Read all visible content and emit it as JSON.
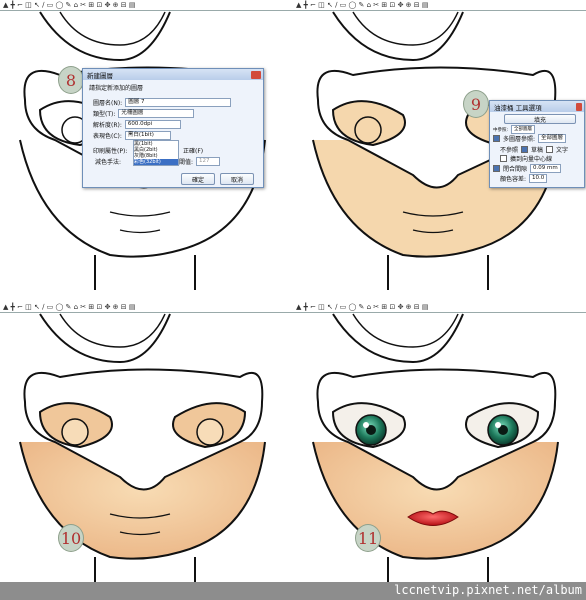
{
  "toolbar_glyphs": "▲ ╋ ⌐ ◫ ↖ ∕ ▭ ◯ ✎ ⌂ ✂ ⊞ ⊡ ✥ ⊕ ⊟ ▤",
  "steps": [
    "8",
    "9",
    "10",
    "11"
  ],
  "new_layer_dialog": {
    "title": "新建圖層",
    "prompt": "請指定新添加的圖層",
    "name_label": "圖層名(N):",
    "name_value": "圖層 7",
    "type_label": "類型(T):",
    "type_value": "光柵圖層",
    "resolution_label": "解析度(R):",
    "resolution_value": "600.0dpi",
    "color_label": "表現色(C):",
    "color_value": "黑白(1bit)",
    "options": [
      "黑(1bit)",
      "黑白(2bit)",
      "灰階(8bit)",
      "彩色(32bit)"
    ],
    "print_label": "印刷屬性(P):",
    "screen_label": "減色手法:",
    "normal_label": "正確(F)",
    "threshold_label": "閾值:",
    "threshold_value": "127",
    "ok_label": "確定",
    "cancel_label": "取消"
  },
  "fill_tool_options": {
    "title": "油漆桶 工具選項",
    "fill_button": "填充",
    "multi_layer_label": "多圖層參照:",
    "multi_layer_value": "全部圖層",
    "opt_not_ref": "不參照",
    "opt_draft": "草稿",
    "opt_text": "文字",
    "expand_center": "擴到向量中心線",
    "close_gap_label": "閉合間隙",
    "close_gap_value": "0.09 mm",
    "color_tolerance_label": "顏色容差:",
    "color_tolerance_value": "10.0",
    "small_label": "中參照:",
    "small_value": "全部圖層"
  },
  "watermark": "lccnetvip.pixnet.net/album",
  "colors": {
    "skin": "#f5d7ad",
    "iris": "#1e7a5c",
    "lips": "#d0141b",
    "footer": "#8d8d8d"
  }
}
